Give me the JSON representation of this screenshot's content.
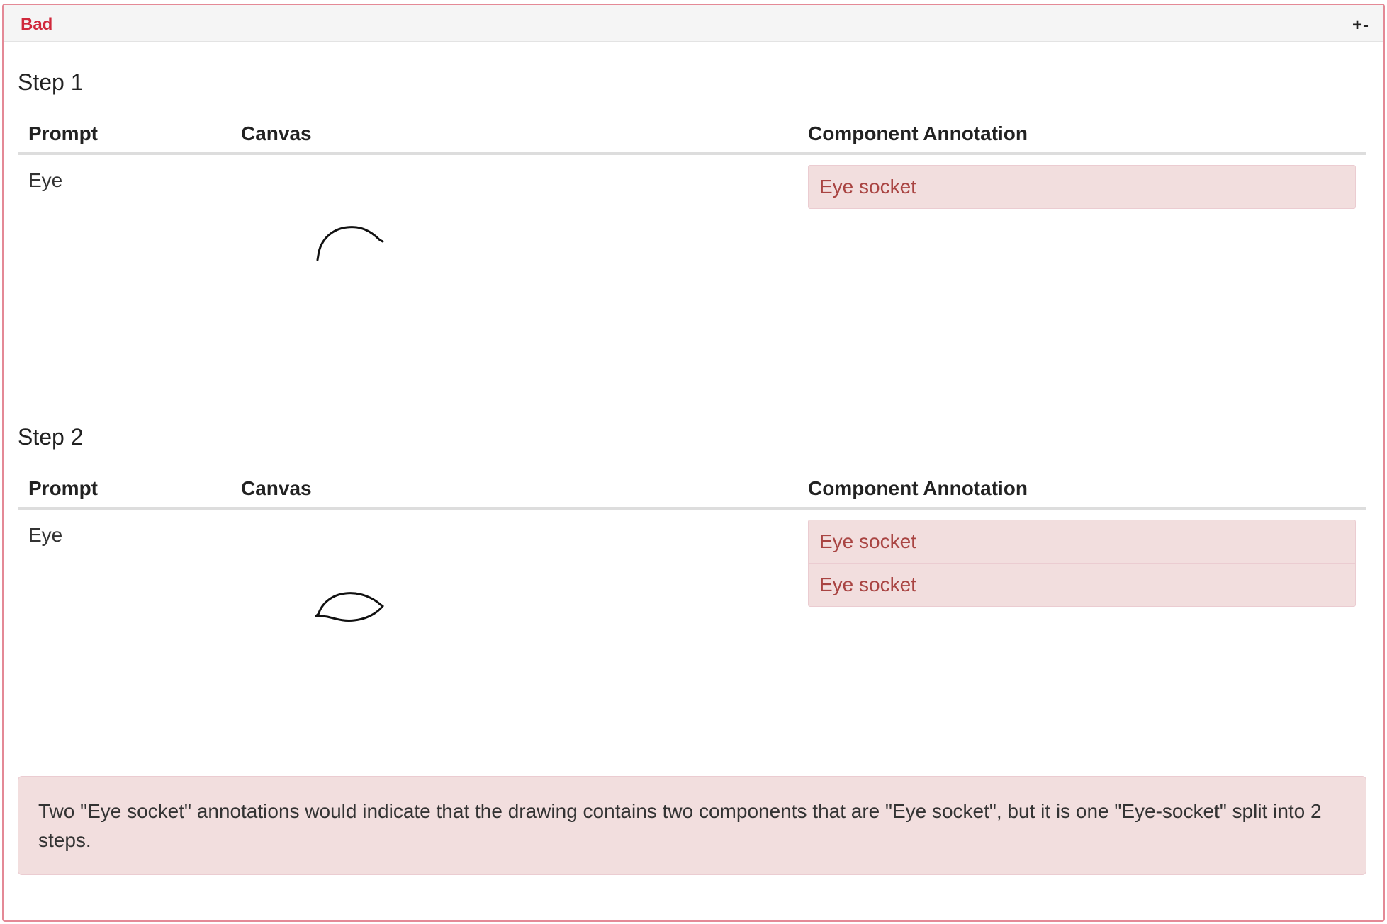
{
  "panel": {
    "title": "Bad",
    "toggle_label": "+-"
  },
  "colors": {
    "title_red": "#d0283b",
    "alert_bg": "#f2dede",
    "alert_border": "#ebccd1",
    "annotation_text": "#a94442"
  },
  "steps": [
    {
      "title": "Step 1",
      "headers": {
        "prompt": "Prompt",
        "canvas": "Canvas",
        "annotation": "Component Annotation"
      },
      "prompt": "Eye",
      "annotations": [
        "Eye socket"
      ]
    },
    {
      "title": "Step 2",
      "headers": {
        "prompt": "Prompt",
        "canvas": "Canvas",
        "annotation": "Component Annotation"
      },
      "prompt": "Eye",
      "annotations": [
        "Eye socket",
        "Eye socket"
      ]
    }
  ],
  "note": "Two \"Eye socket\" annotations would indicate that the drawing contains two components that are \"Eye socket\", but it is one \"Eye-socket\" split into 2 steps."
}
